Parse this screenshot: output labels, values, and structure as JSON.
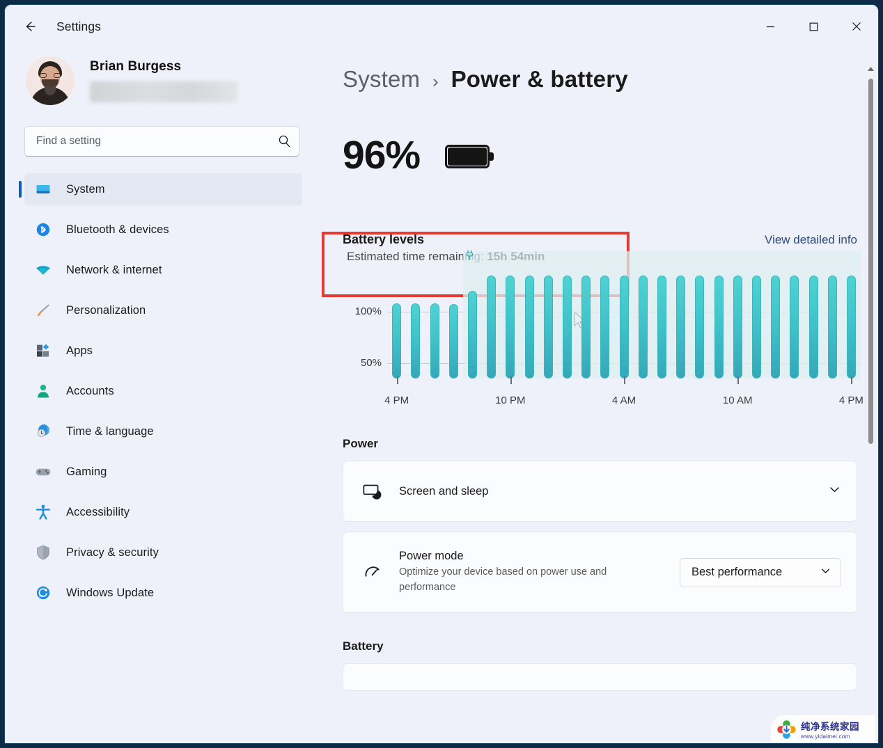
{
  "window": {
    "title": "Settings",
    "back_icon": "back-arrow-icon",
    "minimize_label": "—",
    "maximize_label": "☐",
    "close_label": "✕"
  },
  "sidebar": {
    "profile": {
      "name": "Brian Burgess",
      "avatar": "user-avatar"
    },
    "search": {
      "placeholder": "Find a setting",
      "value": "",
      "icon": "search-icon"
    },
    "items": [
      {
        "label": "System",
        "icon": "system-monitor-icon",
        "active": true
      },
      {
        "label": "Bluetooth & devices",
        "icon": "bluetooth-icon",
        "active": false
      },
      {
        "label": "Network & internet",
        "icon": "wifi-icon",
        "active": false
      },
      {
        "label": "Personalization",
        "icon": "paintbrush-icon",
        "active": false
      },
      {
        "label": "Apps",
        "icon": "apps-grid-icon",
        "active": false
      },
      {
        "label": "Accounts",
        "icon": "person-icon",
        "active": false
      },
      {
        "label": "Time & language",
        "icon": "clock-globe-icon",
        "active": false
      },
      {
        "label": "Gaming",
        "icon": "gamepad-icon",
        "active": false
      },
      {
        "label": "Accessibility",
        "icon": "accessibility-icon",
        "active": false
      },
      {
        "label": "Privacy & security",
        "icon": "shield-icon",
        "active": false
      },
      {
        "label": "Windows Update",
        "icon": "update-refresh-icon",
        "active": false
      }
    ]
  },
  "main": {
    "breadcrumb": {
      "parent": "System",
      "separator": "›",
      "current": "Power & battery"
    },
    "battery": {
      "percent_label": "96%",
      "icon": "battery-full-icon",
      "estimate_prefix": "Estimated time remaining: ",
      "estimate_value": "15h 54min",
      "highlight_color": "#e83a34"
    },
    "battery_levels": {
      "title": "Battery levels",
      "detail_link": "View detailed info",
      "link_color": "#2a4a7c"
    },
    "power": {
      "group_title": "Power",
      "screen_and_sleep": {
        "title": "Screen and sleep",
        "icon": "screen-sleep-icon",
        "chevron": "chevron-down-icon"
      },
      "power_mode": {
        "title": "Power mode",
        "subtitle": "Optimize your device based on power use and performance",
        "icon": "gauge-icon",
        "selected": "Best performance",
        "chevron": "chevron-down-icon"
      }
    },
    "battery_group_title": "Battery"
  },
  "watermark": {
    "cn": "纯净系统家园",
    "url": "www.yidaimei.com"
  },
  "chart_data": {
    "type": "bar",
    "title": "Battery levels",
    "xlabel": "",
    "ylabel": "",
    "ylim": [
      0,
      110
    ],
    "ytick_labels": [
      "50%",
      "100%"
    ],
    "ytick_values": [
      50,
      100
    ],
    "grid": true,
    "legend": false,
    "xtick_labels": [
      "4 PM",
      "10 PM",
      "4 AM",
      "10 AM",
      "4 PM"
    ],
    "xtick_indices": [
      0,
      6,
      12,
      18,
      24
    ],
    "bar_color": "#41c3ca",
    "charging_region_color": "#deeff1",
    "charging_start_index": 4,
    "annotation": "plug-icon at charging start",
    "values": [
      73,
      73,
      73,
      72,
      85,
      100,
      100,
      100,
      100,
      100,
      100,
      100,
      100,
      100,
      100,
      100,
      100,
      100,
      100,
      100,
      100,
      100,
      100,
      100,
      100
    ]
  }
}
